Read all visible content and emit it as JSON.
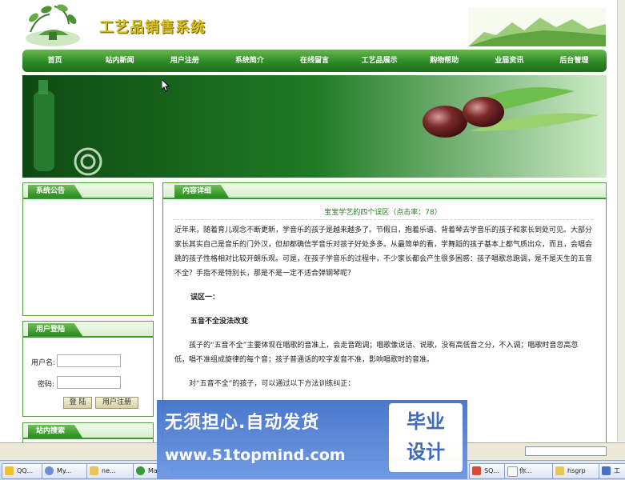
{
  "site": {
    "title": "工艺品销售系统"
  },
  "nav": {
    "items": [
      "首页",
      "站内新闻",
      "用户注册",
      "系统简介",
      "在线留言",
      "工艺品展示",
      "购物帮助",
      "业届资讯",
      "后台管理"
    ]
  },
  "sidebar": {
    "notice_title": "系统公告",
    "login_title": "用户登陆",
    "username_label": "用户名:",
    "password_label": "密码:",
    "login_button": "登 陆",
    "register_button": "用户注册",
    "search_title": "站内搜索"
  },
  "content": {
    "panel_title": "内容详细",
    "article_title": "宝宝学艺的四个误区（点击率：78）",
    "paragraphs": [
      "近年来，随着育儿观念不断更新，学音乐的孩子是越来越多了。节假日，抱着乐谱、背着琴去学音乐的孩子和家长到处可见。大部分家长其实自己是音乐的门外汉，但却都确信学音乐对孩子好处多多。从最简单的看，学舞蹈的孩子基本上都气质出众，而且，会唱会跳的孩子性格相对比较开朗乐观。可是，在孩子学音乐的过程中，不少家长都会产生很多困惑：孩子唱歌总跑调，是不是天生的五音不全？手指不是特别长，那是不是一定不适合弹钢琴呢？",
      "误区一：",
      "五音不全没法改变",
      "孩子的“五音不全”主要体现在唱歌的音准上，会走音跑调；唱歌像说话、说歌，没有高低音之分，不入调；唱歌时音忽高忽低，唱不准组成旋律的每个音；孩子普通话的咬字发音不准，影响唱歌时的音准。",
      "对“五音不全”的孩子，可以通过以下方法训练纠正："
    ]
  },
  "ad": {
    "line1": "无须担心.自动发货",
    "line2": "www.51topmind.com",
    "badge_line1": "毕业",
    "badge_line2": "设计"
  },
  "taskbar": {
    "items": [
      "QQ...",
      "My...",
      "ne...",
      "Ma...",
      "SQ...",
      "你...",
      "hsgrp",
      "工"
    ]
  }
}
